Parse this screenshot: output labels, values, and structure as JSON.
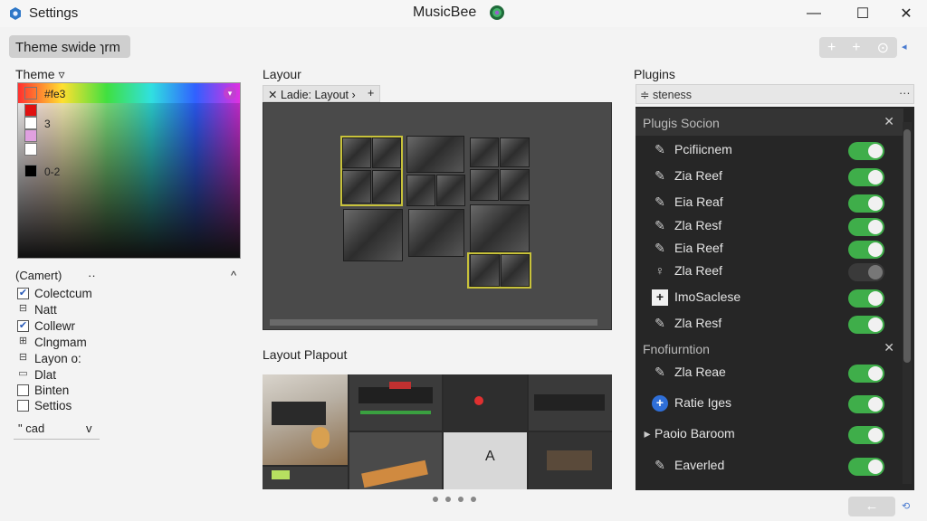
{
  "window": {
    "left_title": "Settings",
    "center_title": "MusicBee",
    "controls": {
      "minimize": "—",
      "maximize": "☐",
      "close": "✕"
    }
  },
  "toolbar": {
    "tab_label": "Theme swide ɿrm",
    "right_buttons": [
      "+",
      "+",
      "⊙"
    ]
  },
  "theme": {
    "label": "Theme ▿",
    "swatches": [
      {
        "label": "#fe3",
        "color": "#000000"
      },
      {
        "label": "3",
        "color": "#e01010"
      },
      {
        "label": "",
        "color": "#ffffff"
      },
      {
        "label": "",
        "color": "#e0a0e0"
      },
      {
        "label": "",
        "color": "#ffffff"
      },
      {
        "label": "0-2",
        "color": "#000000"
      }
    ],
    "camera_label": "(Camert)",
    "camera_dots": "··",
    "camera_chevron": "^",
    "options": [
      {
        "label": "Colectcum",
        "state": "checked"
      },
      {
        "label": "Natt",
        "state": "glyph",
        "glyph": "⊟"
      },
      {
        "label": "Collewr",
        "state": "checked"
      },
      {
        "label": "Clngmam",
        "state": "glyph",
        "glyph": "⊞"
      },
      {
        "label": "Layon o:",
        "state": "glyph",
        "glyph": "⊟"
      },
      {
        "label": "Dlat",
        "state": "glyph",
        "glyph": "▭"
      },
      {
        "label": "Binten",
        "state": "unchecked"
      },
      {
        "label": "Settios",
        "state": "unchecked"
      }
    ],
    "pad_select": "\" cad",
    "pad_chevron": "v"
  },
  "layout": {
    "label": "Layour",
    "tab_label": "✕ Ladie: Layout ›",
    "tab_add": "+",
    "preview_label": "Layout Plapout",
    "preview_count": 4
  },
  "plugins": {
    "label": "Plugins",
    "search_value": "≑ steness",
    "search_menu": "···",
    "sections": [
      {
        "header": "Plugis Socion",
        "close": "✕",
        "items": [
          {
            "label": "Pcifiicnem",
            "icon": "✎",
            "enabled": true
          },
          {
            "label": "Zia Reef",
            "icon": "✎",
            "enabled": true
          },
          {
            "label": "Eia Reaf",
            "icon": "✎",
            "enabled": true
          },
          {
            "label": "Zla Resf",
            "icon": "✎",
            "enabled": true
          },
          {
            "label": "Eia Reef",
            "icon": "✎",
            "enabled": true
          },
          {
            "label": "Zla Reef",
            "icon": "♀",
            "enabled": false
          },
          {
            "label": "ImoSaclese",
            "icon": "+",
            "enabled": true
          },
          {
            "label": "Zla Resf",
            "icon": "✎",
            "enabled": true
          }
        ]
      },
      {
        "header": "Fnofiurntion",
        "close": "✕",
        "items": [
          {
            "label": "Zla Reae",
            "icon": "✎",
            "enabled": true
          },
          {
            "label": "Ratie Iges",
            "icon": "+",
            "enabled": true
          },
          {
            "label": "Paoio Baroom",
            "icon": "▸",
            "enabled": true
          },
          {
            "label": "Eaverled",
            "icon": "✎",
            "enabled": true
          }
        ]
      }
    ],
    "back_button": "←"
  },
  "colors": {
    "accent_toggle": "#3fae4a",
    "selection_outline": "#c8c23a",
    "panel_dark": "#262626"
  }
}
